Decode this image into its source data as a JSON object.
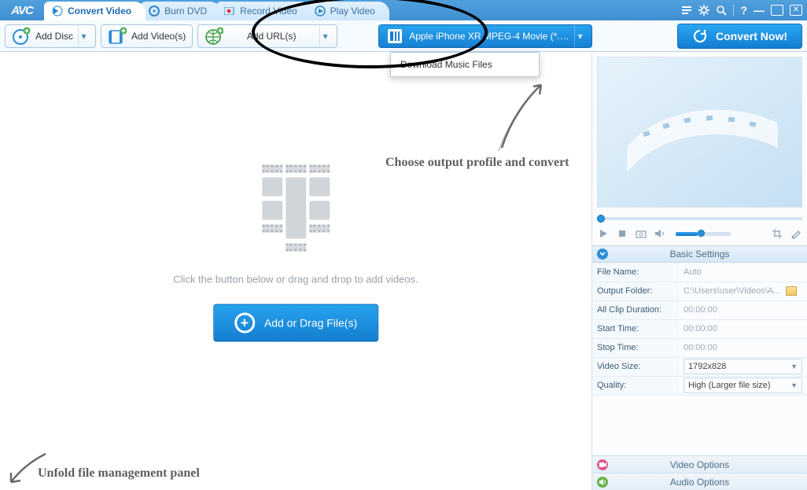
{
  "app": {
    "logo_text": "AVC"
  },
  "tabs": [
    {
      "label": "Convert Video"
    },
    {
      "label": "Burn DVD"
    },
    {
      "label": "Record Video"
    },
    {
      "label": "Play Video"
    }
  ],
  "toolbar": {
    "add_disc": "Add Disc",
    "add_videos": "Add Video(s)",
    "add_url": "Add URL(s)",
    "url_menu_item": "Download Music Files",
    "profile": "Apple iPhone XR MPEG-4 Movie (*.m...",
    "convert": "Convert Now!"
  },
  "placeholder": {
    "instruction": "Click the button below or drag and drop to add videos.",
    "add_button": "Add or Drag File(s)"
  },
  "annotations": {
    "choose_profile": "Choose output profile and convert",
    "unfold_panel": "Unfold file management panel"
  },
  "settings": {
    "header": "Basic Settings",
    "rows": {
      "file_name": {
        "label": "File Name:",
        "value": "Auto"
      },
      "output_folder": {
        "label": "Output Folder:",
        "value": "C:\\Users\\user\\Videos\\A..."
      },
      "all_clip": {
        "label": "All Clip Duration:",
        "value": "00:00:00"
      },
      "start_time": {
        "label": "Start Time:",
        "value": "00:00:00"
      },
      "stop_time": {
        "label": "Stop Time:",
        "value": "00:00:00"
      },
      "video_size": {
        "label": "Video Size:",
        "value": "1792x828"
      },
      "quality": {
        "label": "Quality:",
        "value": "High (Larger file size)"
      }
    },
    "video_options": "Video Options",
    "audio_options": "Audio Options"
  }
}
